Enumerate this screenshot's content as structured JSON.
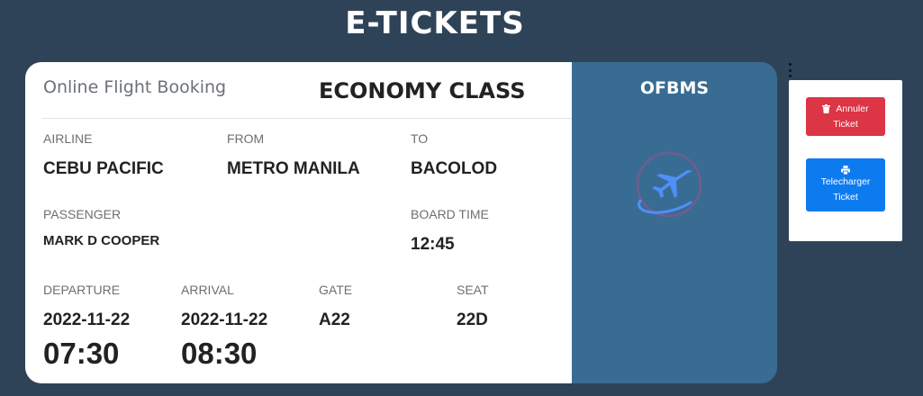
{
  "page": {
    "title": "E-TICKETS"
  },
  "ticket": {
    "brand": "Online Flight Booking",
    "class_label": "ECONOMY CLASS",
    "side_title": "OFBMS",
    "labels": {
      "airline": "AIRLINE",
      "from": "FROM",
      "to": "TO",
      "passenger": "PASSENGER",
      "board_time": "BOARD TIME",
      "departure": "DEPARTURE",
      "arrival": "ARRIVAL",
      "gate": "GATE",
      "seat": "SEAT"
    },
    "values": {
      "airline": "CEBU PACIFIC",
      "from": "METRO MANILA",
      "to": "BACOLOD",
      "passenger": "MARK D COOPER",
      "board_time": "12:45",
      "departure_date": "2022-11-22",
      "departure_time": "07:30",
      "arrival_date": "2022-11-22",
      "arrival_time": "08:30",
      "gate": "A22",
      "seat": "22D"
    }
  },
  "actions": {
    "cancel": {
      "label_line1": "Annuler",
      "label_line2": "Ticket",
      "icon": "trash-icon",
      "color": "#dc3545"
    },
    "download": {
      "label_line1": "Telecharger",
      "label_line2": "Ticket",
      "icon": "print-icon",
      "color": "#0d7bf0"
    }
  },
  "colors": {
    "background": "#2f4358",
    "side_panel": "#386c92",
    "logo_accent": "#4f8ff7"
  }
}
